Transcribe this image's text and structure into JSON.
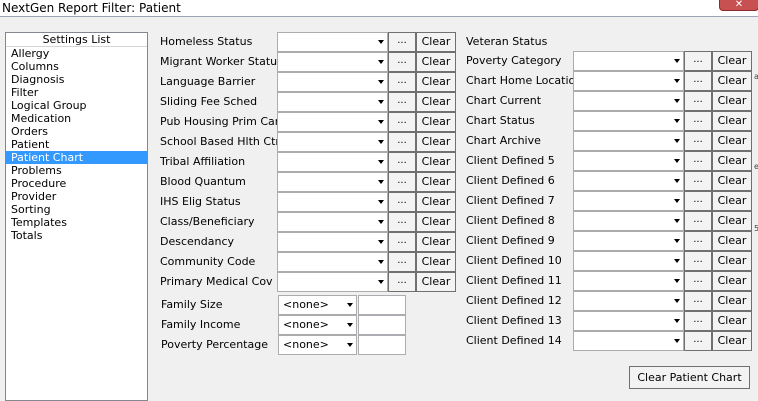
{
  "window": {
    "title": "NextGen Report Filter: Patient",
    "close_label": "✕"
  },
  "settings": {
    "header": "Settings List",
    "items": [
      "Allergy",
      "Columns",
      "Diagnosis",
      "Filter",
      "Logical Group",
      "Medication",
      "Orders",
      "Patient",
      "Patient Chart",
      "Problems",
      "Procedure",
      "Provider",
      "Sorting",
      "Templates",
      "Totals"
    ],
    "selected": "Patient Chart"
  },
  "left_filters": [
    {
      "label": "Homeless Status"
    },
    {
      "label": "Migrant Worker Status"
    },
    {
      "label": "Language Barrier"
    },
    {
      "label": "Sliding Fee Sched"
    },
    {
      "label": "Pub Housing Prim Care"
    },
    {
      "label": "School Based Hlth Ctr"
    },
    {
      "label": "Tribal Affiliation"
    },
    {
      "label": "Blood Quantum"
    },
    {
      "label": "IHS Elig Status"
    },
    {
      "label": "Class/Beneficiary"
    },
    {
      "label": "Descendancy"
    },
    {
      "label": "Community Code"
    },
    {
      "label": "Primary Medical Cov"
    }
  ],
  "left_numeric": [
    {
      "label": "Family Size",
      "value": "<none>"
    },
    {
      "label": "Family Income",
      "value": "<none>"
    },
    {
      "label": "Poverty Percentage",
      "value": "<none>"
    }
  ],
  "right_header": "Veteran Status",
  "right_filters": [
    {
      "label": "Poverty Category"
    },
    {
      "label": "Chart Home Location"
    },
    {
      "label": "Chart Current"
    },
    {
      "label": "Chart Status"
    },
    {
      "label": "Chart Archive"
    },
    {
      "label": "Client Defined 5"
    },
    {
      "label": "Client Defined 6"
    },
    {
      "label": "Client Defined 7"
    },
    {
      "label": "Client Defined 8"
    },
    {
      "label": "Client Defined 9"
    },
    {
      "label": "Client Defined 10"
    },
    {
      "label": "Client Defined 11"
    },
    {
      "label": "Client Defined 12"
    },
    {
      "label": "Client Defined 13"
    },
    {
      "label": "Client Defined 14"
    }
  ],
  "buttons": {
    "dots": "...",
    "clear": "Clear",
    "clear_chart": "Clear Patient Chart"
  }
}
